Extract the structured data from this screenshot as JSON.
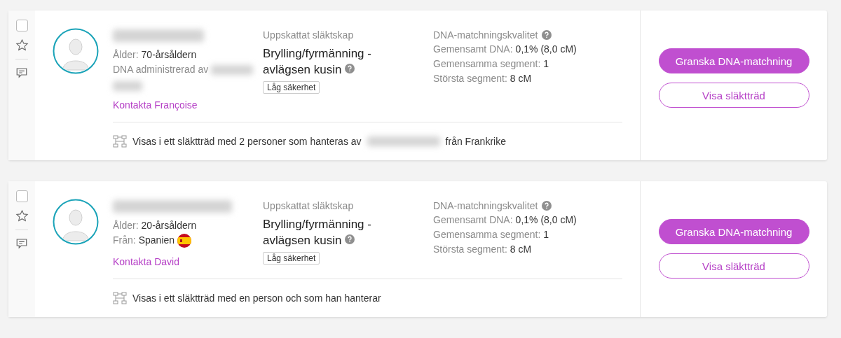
{
  "matches": [
    {
      "checked": false,
      "starred": false,
      "details": [
        {
          "kind": "plain",
          "label": "Ålder:",
          "value": "70-årsåldern"
        },
        {
          "kind": "redacted",
          "label": "DNA administrerad av"
        }
      ],
      "contact": "Kontakta Françoise",
      "relationship_label": "Uppskattat släktskap",
      "relationship": "Brylling/fyrmänning - avlägsen kusin",
      "confidence": "Låg säkerhet",
      "quality_label": "DNA-matchningskvalitet",
      "stats": [
        {
          "label": "Gemensamt DNA:",
          "value": "0,1% (8,0 cM)"
        },
        {
          "label": "Gemensamma segment:",
          "value": "1"
        },
        {
          "label": "Största segment:",
          "value": "8 cM"
        }
      ],
      "tree_text": "Visas i ett släktträd med 2 personer som hanteras av",
      "tree_redacted": true,
      "tree_suffix": "från Frankrike",
      "primary_button": "Granska DNA-matchning",
      "secondary_button": "Visa släktträd"
    },
    {
      "checked": false,
      "starred": false,
      "details": [
        {
          "kind": "plain",
          "label": "Ålder:",
          "value": "20-årsåldern"
        },
        {
          "kind": "country",
          "label": "Från:",
          "value": "Spanien"
        }
      ],
      "contact": "Kontakta David",
      "relationship_label": "Uppskattat släktskap",
      "relationship": "Brylling/fyrmänning - avlägsen kusin",
      "confidence": "Låg säkerhet",
      "quality_label": "DNA-matchningskvalitet",
      "stats": [
        {
          "label": "Gemensamt DNA:",
          "value": "0,1% (8,0 cM)"
        },
        {
          "label": "Gemensamma segment:",
          "value": "1"
        },
        {
          "label": "Största segment:",
          "value": "8 cM"
        }
      ],
      "tree_text": "Visas i ett släktträd med en person och som han hanterar",
      "tree_redacted": false,
      "primary_button": "Granska DNA-matchning",
      "secondary_button": "Visa släktträd"
    }
  ]
}
